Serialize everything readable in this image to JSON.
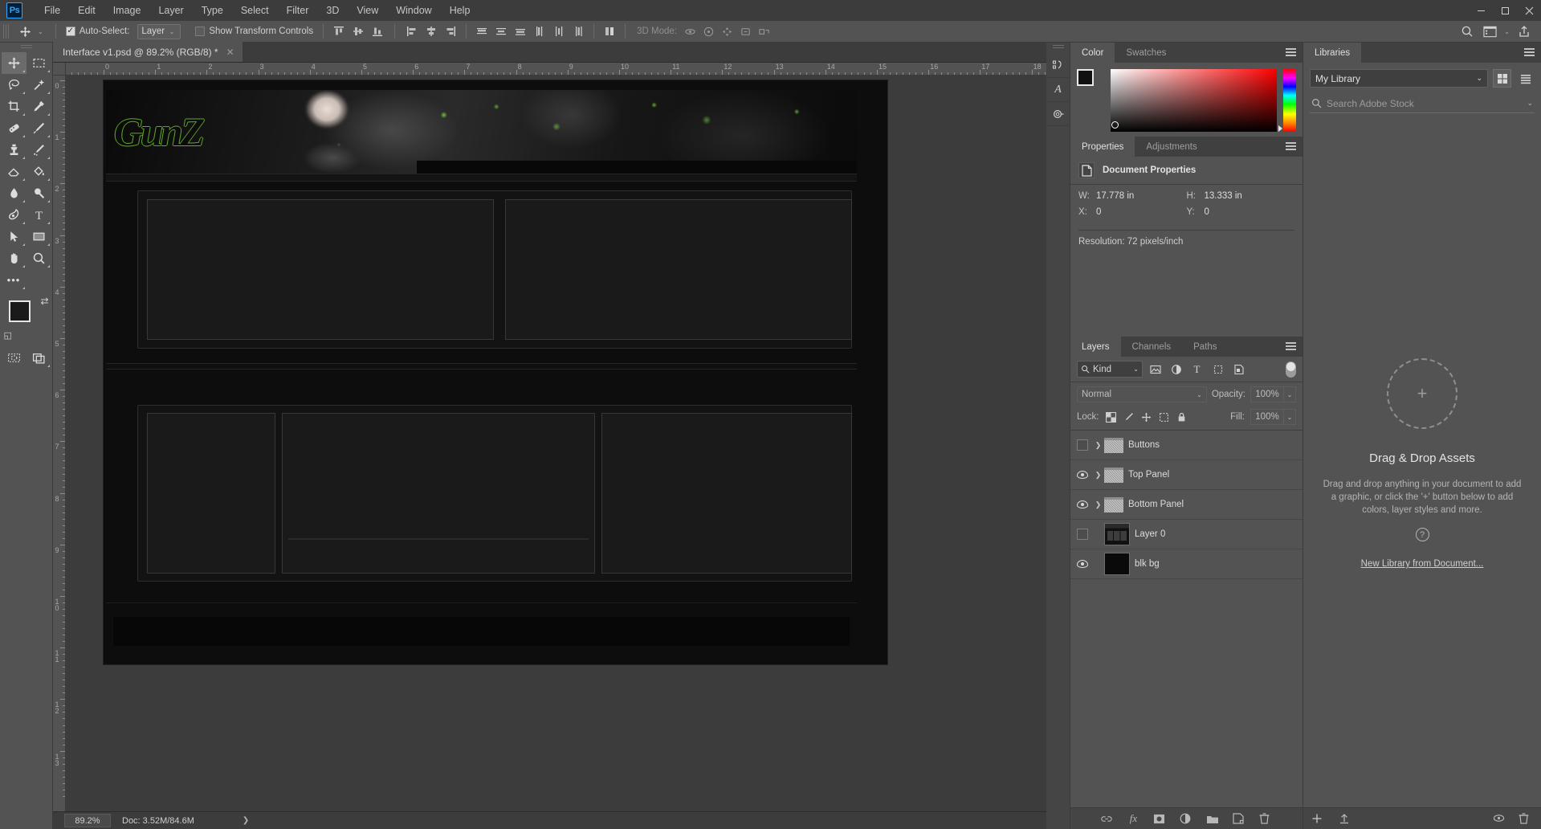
{
  "app": {
    "name": "Ps",
    "window_buttons": [
      "minimize",
      "maximize",
      "close"
    ]
  },
  "menubar": {
    "items": [
      "File",
      "Edit",
      "Image",
      "Layer",
      "Type",
      "Select",
      "Filter",
      "3D",
      "View",
      "Window",
      "Help"
    ]
  },
  "options_bar": {
    "active_tool": "move-tool",
    "auto_select_checked": true,
    "auto_select_label": "Auto-Select:",
    "auto_select_value": "Layer",
    "show_transform_label": "Show Transform Controls",
    "show_transform_checked": false,
    "mode_3d_label": "3D Mode:",
    "align_icons": [
      "align-top-edges",
      "align-vertical-centers",
      "align-bottom-edges",
      "align-left-edges",
      "align-horizontal-centers",
      "align-right-edges"
    ],
    "distribute_icons": [
      "distribute-top-edges",
      "distribute-vertical-centers",
      "distribute-bottom-edges",
      "distribute-left-edges",
      "distribute-horizontal-centers",
      "distribute-right-edges"
    ],
    "extra_icons": [
      "align-options"
    ],
    "right_icons": [
      "search-icon",
      "workspace-switcher-icon",
      "chevron-down-icon",
      "share-icon"
    ]
  },
  "toolbar": {
    "tools": [
      {
        "name": "move-tool",
        "glyph": "✥",
        "active": true
      },
      {
        "name": "rectangular-marquee-tool",
        "glyph": "▢",
        "active": false
      },
      {
        "name": "lasso-tool",
        "glyph": "🖛",
        "active": false
      },
      {
        "name": "magic-wand-tool",
        "glyph": "✧",
        "active": false
      },
      {
        "name": "crop-tool",
        "glyph": "⌗",
        "active": false
      },
      {
        "name": "eyedropper-tool",
        "glyph": "⟋",
        "active": false
      },
      {
        "name": "healing-brush-tool",
        "glyph": "✚",
        "active": false
      },
      {
        "name": "brush-tool",
        "glyph": "✎",
        "active": false
      },
      {
        "name": "clone-stamp-tool",
        "glyph": "⚒",
        "active": false
      },
      {
        "name": "history-brush-tool",
        "glyph": "⌁",
        "active": false
      },
      {
        "name": "eraser-tool",
        "glyph": "▱",
        "active": false
      },
      {
        "name": "gradient-tool",
        "glyph": "◨",
        "active": false
      },
      {
        "name": "blur-tool",
        "glyph": "💧",
        "active": false
      },
      {
        "name": "dodge-tool",
        "glyph": "🔍",
        "active": false
      },
      {
        "name": "pen-tool",
        "glyph": "✒",
        "active": false
      },
      {
        "name": "type-tool",
        "glyph": "T",
        "active": false
      },
      {
        "name": "path-selection-tool",
        "glyph": "➤",
        "active": false
      },
      {
        "name": "rectangle-shape-tool",
        "glyph": "▭",
        "active": false
      },
      {
        "name": "hand-tool",
        "glyph": "✋",
        "active": false
      },
      {
        "name": "zoom-tool",
        "glyph": "🔎",
        "active": false
      }
    ],
    "more_tools": "•••",
    "foreground_color": "#1a1a1a",
    "background_color": "#262626",
    "quick_mask_icon": "quick-mask-mode-icon",
    "screen_mode_icon": "screen-mode-icon"
  },
  "document": {
    "tab_title": "Interface v1.psd @ 89.2% (RGB/8) *",
    "close_glyph": "✕",
    "ruler_unit": "in",
    "ruler_h_ticks": [
      0,
      1,
      2,
      3,
      4,
      5,
      6,
      7,
      8,
      9,
      10,
      11,
      12,
      13,
      14,
      15,
      16,
      17,
      18
    ],
    "ruler_v_ticks": [
      0,
      1,
      2,
      3,
      4,
      5,
      6,
      7,
      8,
      9,
      10,
      11,
      12,
      13
    ]
  },
  "statusbar": {
    "zoom": "89.2%",
    "doc_size": "Doc: 3.52M/84.6M",
    "arrow": "❯"
  },
  "collapsed_panels": {
    "icons": [
      "paths-actions-icon",
      "character-panel-icon",
      "brush-settings-icon"
    ]
  },
  "color_panel": {
    "tabs": [
      {
        "label": "Color",
        "active": true
      },
      {
        "label": "Swatches",
        "active": false
      }
    ],
    "foreground_hex": "#111111",
    "background_hex": "#111111",
    "menu_icon": "panel-menu-icon"
  },
  "properties_panel": {
    "tabs": [
      {
        "label": "Properties",
        "active": true
      },
      {
        "label": "Adjustments",
        "active": false
      }
    ],
    "header_icon": "document-icon",
    "header_title": "Document Properties",
    "fields": [
      {
        "key": "W:",
        "value": "17.778 in"
      },
      {
        "key": "H:",
        "value": "13.333 in"
      },
      {
        "key": "X:",
        "value": "0"
      },
      {
        "key": "Y:",
        "value": "0"
      }
    ],
    "resolution": "Resolution: 72 pixels/inch",
    "menu_icon": "panel-menu-icon"
  },
  "layers_panel": {
    "tabs": [
      {
        "label": "Layers",
        "active": true
      },
      {
        "label": "Channels",
        "active": false
      },
      {
        "label": "Paths",
        "active": false
      }
    ],
    "filter_kind": "Kind",
    "filter_icons": [
      "filter-pixel-icon",
      "filter-adjustment-icon",
      "filter-type-icon",
      "filter-shape-icon",
      "filter-smart-object-icon"
    ],
    "filter_toggle": "filter-enable-toggle",
    "blend_mode": "Normal",
    "opacity_label": "Opacity:",
    "opacity_value": "100%",
    "lock_label": "Lock:",
    "lock_icons": [
      "lock-transparent-pixels-icon",
      "lock-image-pixels-icon",
      "lock-position-icon",
      "lock-artboard-icon",
      "lock-all-icon"
    ],
    "fill_label": "Fill:",
    "fill_value": "100%",
    "layers": [
      {
        "name": "Buttons",
        "visible": false,
        "type": "group"
      },
      {
        "name": "Top Panel",
        "visible": true,
        "type": "group"
      },
      {
        "name": "Bottom Panel",
        "visible": true,
        "type": "group"
      },
      {
        "name": "Layer 0",
        "visible": false,
        "type": "art"
      },
      {
        "name": "blk bg",
        "visible": true,
        "type": "black"
      }
    ],
    "bottom_icons": [
      "link-layers-icon",
      "layer-style-fx-icon",
      "add-layer-mask-icon",
      "new-adjustment-layer-icon",
      "new-group-icon",
      "new-layer-icon",
      "delete-layer-icon"
    ],
    "menu_icon": "panel-menu-icon"
  },
  "libraries_panel": {
    "tabs": [
      {
        "label": "Libraries",
        "active": true
      }
    ],
    "library_select": "My Library",
    "view_grid_icon": "grid-view-icon",
    "view_list_icon": "list-view-icon",
    "search_placeholder": "Search Adobe Stock",
    "search_value": "",
    "empty_title": "Drag & Drop Assets",
    "empty_desc": "Drag and drop anything in your document to add a graphic, or click the '+' button below to add colors, layer styles and more.",
    "help_glyph": "?",
    "new_library_link": "New Library from Document...",
    "bottom_icons": [
      "add-content-icon",
      "upload-icon",
      "sync-icon",
      "delete-icon"
    ],
    "menu_icon": "panel-menu-icon"
  },
  "canvas": {
    "artwork_title": "GunZ",
    "banner_alt": "dark smoky game banner with green outlined GunZ logo and anime character"
  }
}
